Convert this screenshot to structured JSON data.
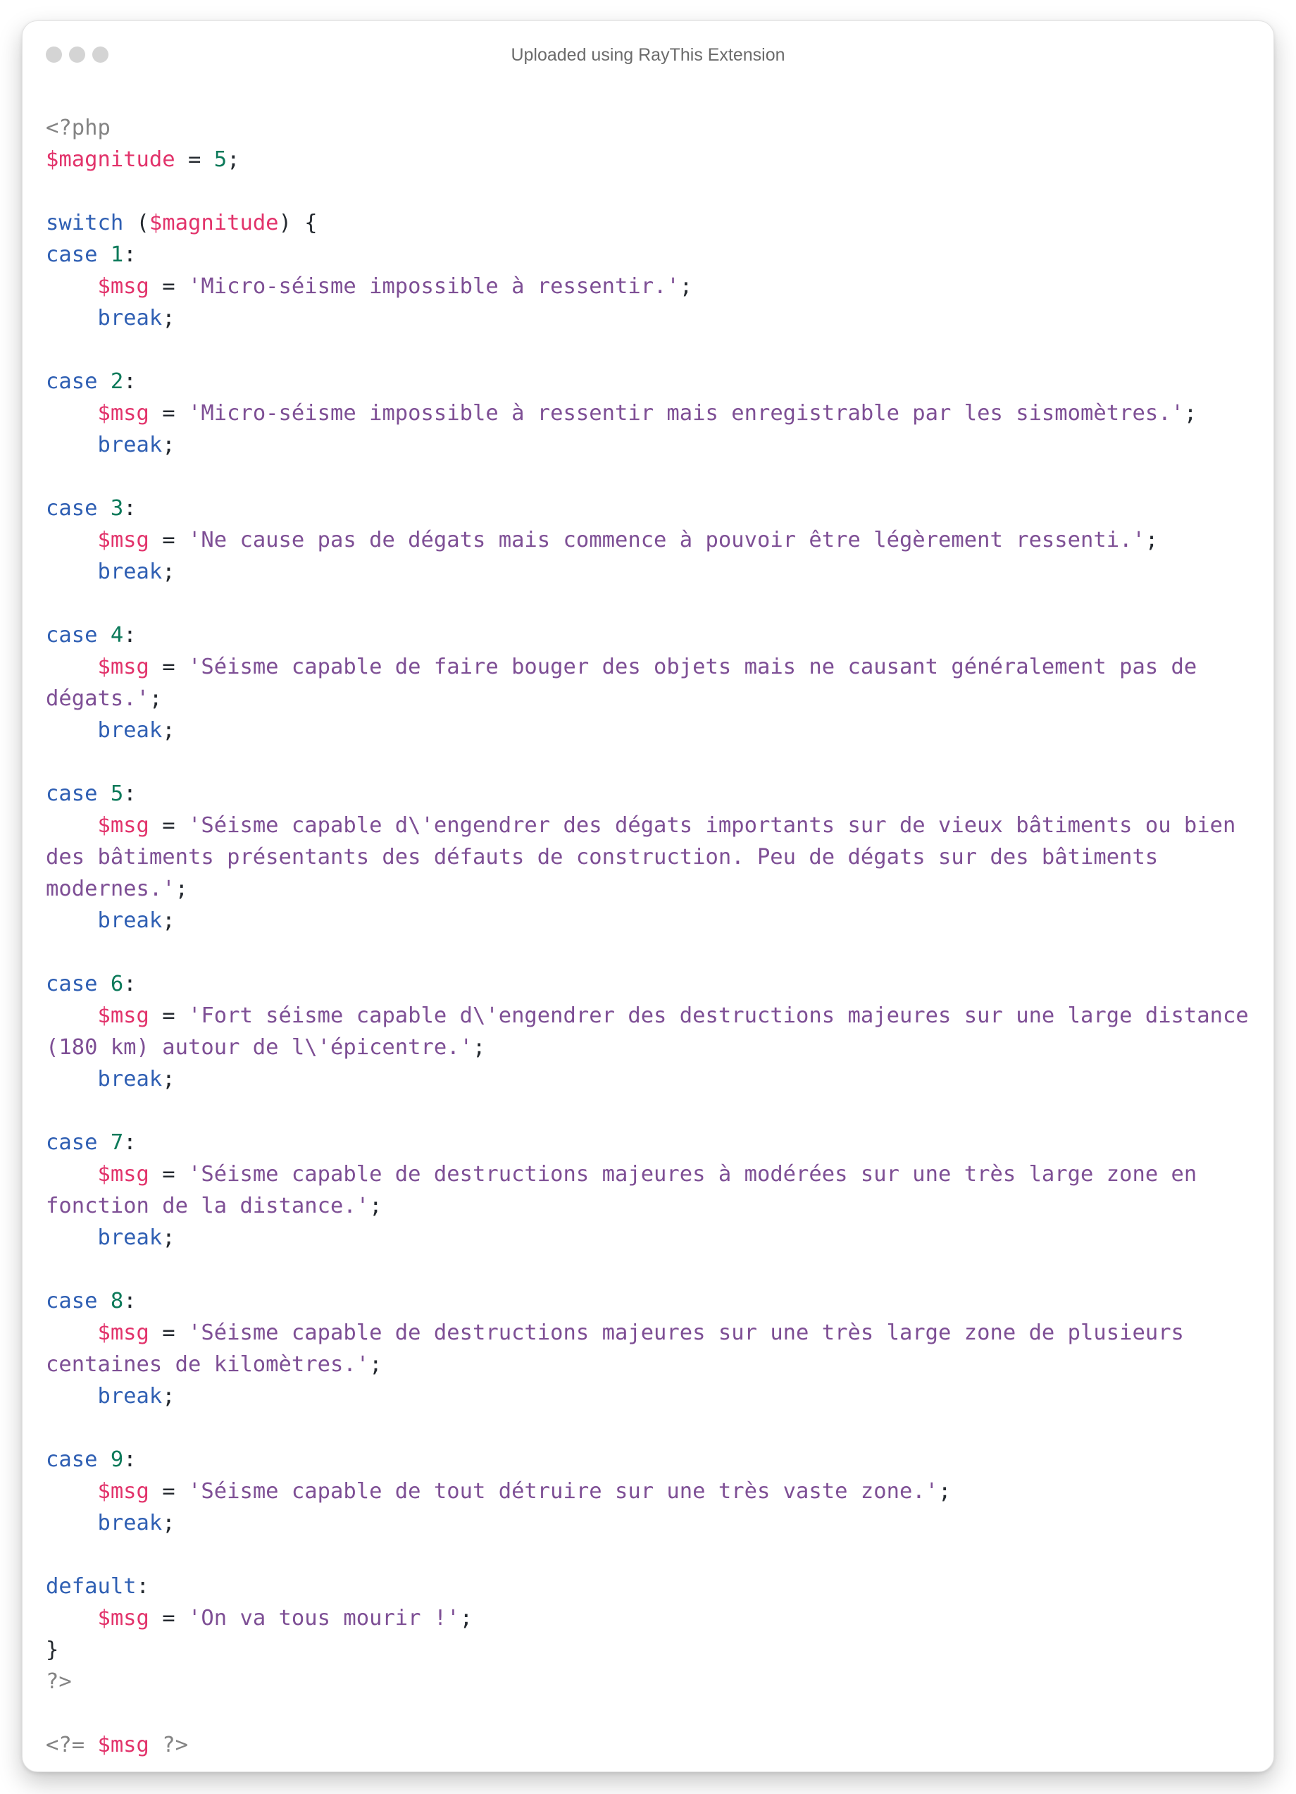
{
  "window": {
    "title": "Uploaded using RayThis Extension"
  },
  "colors": {
    "variable": "#e2336b",
    "keyword": "#2f5fb3",
    "number": "#0c7a5a",
    "string": "#7e4f95",
    "meta": "#848484",
    "plain": "#24292f"
  },
  "code": {
    "lines": [
      [
        {
          "t": "meta",
          "v": "<?php"
        }
      ],
      [
        {
          "t": "var",
          "v": "$magnitude"
        },
        {
          "t": "plain",
          "v": " = "
        },
        {
          "t": "num",
          "v": "5"
        },
        {
          "t": "plain",
          "v": ";"
        }
      ],
      [],
      [
        {
          "t": "kw",
          "v": "switch"
        },
        {
          "t": "plain",
          "v": " ("
        },
        {
          "t": "var",
          "v": "$magnitude"
        },
        {
          "t": "plain",
          "v": ") {"
        }
      ],
      [
        {
          "t": "kw",
          "v": "case"
        },
        {
          "t": "plain",
          "v": " "
        },
        {
          "t": "num",
          "v": "1"
        },
        {
          "t": "plain",
          "v": ":"
        }
      ],
      [
        {
          "t": "plain",
          "v": "    "
        },
        {
          "t": "var",
          "v": "$msg"
        },
        {
          "t": "plain",
          "v": " = "
        },
        {
          "t": "str",
          "v": "'Micro-séisme impossible à ressentir.'"
        },
        {
          "t": "plain",
          "v": ";"
        }
      ],
      [
        {
          "t": "plain",
          "v": "    "
        },
        {
          "t": "kw",
          "v": "break"
        },
        {
          "t": "plain",
          "v": ";"
        }
      ],
      [],
      [
        {
          "t": "kw",
          "v": "case"
        },
        {
          "t": "plain",
          "v": " "
        },
        {
          "t": "num",
          "v": "2"
        },
        {
          "t": "plain",
          "v": ":"
        }
      ],
      [
        {
          "t": "plain",
          "v": "    "
        },
        {
          "t": "var",
          "v": "$msg"
        },
        {
          "t": "plain",
          "v": " = "
        },
        {
          "t": "str",
          "v": "'Micro-séisme impossible à ressentir mais enregistrable par les sismomètres.'"
        },
        {
          "t": "plain",
          "v": ";"
        }
      ],
      [
        {
          "t": "plain",
          "v": "    "
        },
        {
          "t": "kw",
          "v": "break"
        },
        {
          "t": "plain",
          "v": ";"
        }
      ],
      [],
      [
        {
          "t": "kw",
          "v": "case"
        },
        {
          "t": "plain",
          "v": " "
        },
        {
          "t": "num",
          "v": "3"
        },
        {
          "t": "plain",
          "v": ":"
        }
      ],
      [
        {
          "t": "plain",
          "v": "    "
        },
        {
          "t": "var",
          "v": "$msg"
        },
        {
          "t": "plain",
          "v": " = "
        },
        {
          "t": "str",
          "v": "'Ne cause pas de dégats mais commence à pouvoir être légèrement ressenti.'"
        },
        {
          "t": "plain",
          "v": ";"
        }
      ],
      [
        {
          "t": "plain",
          "v": "    "
        },
        {
          "t": "kw",
          "v": "break"
        },
        {
          "t": "plain",
          "v": ";"
        }
      ],
      [],
      [
        {
          "t": "kw",
          "v": "case"
        },
        {
          "t": "plain",
          "v": " "
        },
        {
          "t": "num",
          "v": "4"
        },
        {
          "t": "plain",
          "v": ":"
        }
      ],
      [
        {
          "t": "plain",
          "v": "    "
        },
        {
          "t": "var",
          "v": "$msg"
        },
        {
          "t": "plain",
          "v": " = "
        },
        {
          "t": "str",
          "v": "'Séisme capable de faire bouger des objets mais ne causant généralement pas de"
        }
      ],
      [
        {
          "t": "str",
          "v": "dégats.'"
        },
        {
          "t": "plain",
          "v": ";"
        }
      ],
      [
        {
          "t": "plain",
          "v": "    "
        },
        {
          "t": "kw",
          "v": "break"
        },
        {
          "t": "plain",
          "v": ";"
        }
      ],
      [],
      [
        {
          "t": "kw",
          "v": "case"
        },
        {
          "t": "plain",
          "v": " "
        },
        {
          "t": "num",
          "v": "5"
        },
        {
          "t": "plain",
          "v": ":"
        }
      ],
      [
        {
          "t": "plain",
          "v": "    "
        },
        {
          "t": "var",
          "v": "$msg"
        },
        {
          "t": "plain",
          "v": " = "
        },
        {
          "t": "str",
          "v": "'Séisme capable d\\'engendrer des dégats importants sur de vieux bâtiments ou bien"
        }
      ],
      [
        {
          "t": "str",
          "v": "des bâtiments présentants des défauts de construction. Peu de dégats sur des bâtiments"
        }
      ],
      [
        {
          "t": "str",
          "v": "modernes.'"
        },
        {
          "t": "plain",
          "v": ";"
        }
      ],
      [
        {
          "t": "plain",
          "v": "    "
        },
        {
          "t": "kw",
          "v": "break"
        },
        {
          "t": "plain",
          "v": ";"
        }
      ],
      [],
      [
        {
          "t": "kw",
          "v": "case"
        },
        {
          "t": "plain",
          "v": " "
        },
        {
          "t": "num",
          "v": "6"
        },
        {
          "t": "plain",
          "v": ":"
        }
      ],
      [
        {
          "t": "plain",
          "v": "    "
        },
        {
          "t": "var",
          "v": "$msg"
        },
        {
          "t": "plain",
          "v": " = "
        },
        {
          "t": "str",
          "v": "'Fort séisme capable d\\'engendrer des destructions majeures sur une large distance"
        }
      ],
      [
        {
          "t": "str",
          "v": "(180 km) autour de l\\'épicentre.'"
        },
        {
          "t": "plain",
          "v": ";"
        }
      ],
      [
        {
          "t": "plain",
          "v": "    "
        },
        {
          "t": "kw",
          "v": "break"
        },
        {
          "t": "plain",
          "v": ";"
        }
      ],
      [],
      [
        {
          "t": "kw",
          "v": "case"
        },
        {
          "t": "plain",
          "v": " "
        },
        {
          "t": "num",
          "v": "7"
        },
        {
          "t": "plain",
          "v": ":"
        }
      ],
      [
        {
          "t": "plain",
          "v": "    "
        },
        {
          "t": "var",
          "v": "$msg"
        },
        {
          "t": "plain",
          "v": " = "
        },
        {
          "t": "str",
          "v": "'Séisme capable de destructions majeures à modérées sur une très large zone en"
        }
      ],
      [
        {
          "t": "str",
          "v": "fonction de la distance.'"
        },
        {
          "t": "plain",
          "v": ";"
        }
      ],
      [
        {
          "t": "plain",
          "v": "    "
        },
        {
          "t": "kw",
          "v": "break"
        },
        {
          "t": "plain",
          "v": ";"
        }
      ],
      [],
      [
        {
          "t": "kw",
          "v": "case"
        },
        {
          "t": "plain",
          "v": " "
        },
        {
          "t": "num",
          "v": "8"
        },
        {
          "t": "plain",
          "v": ":"
        }
      ],
      [
        {
          "t": "plain",
          "v": "    "
        },
        {
          "t": "var",
          "v": "$msg"
        },
        {
          "t": "plain",
          "v": " = "
        },
        {
          "t": "str",
          "v": "'Séisme capable de destructions majeures sur une très large zone de plusieurs"
        }
      ],
      [
        {
          "t": "str",
          "v": "centaines de kilomètres.'"
        },
        {
          "t": "plain",
          "v": ";"
        }
      ],
      [
        {
          "t": "plain",
          "v": "    "
        },
        {
          "t": "kw",
          "v": "break"
        },
        {
          "t": "plain",
          "v": ";"
        }
      ],
      [],
      [
        {
          "t": "kw",
          "v": "case"
        },
        {
          "t": "plain",
          "v": " "
        },
        {
          "t": "num",
          "v": "9"
        },
        {
          "t": "plain",
          "v": ":"
        }
      ],
      [
        {
          "t": "plain",
          "v": "    "
        },
        {
          "t": "var",
          "v": "$msg"
        },
        {
          "t": "plain",
          "v": " = "
        },
        {
          "t": "str",
          "v": "'Séisme capable de tout détruire sur une très vaste zone.'"
        },
        {
          "t": "plain",
          "v": ";"
        }
      ],
      [
        {
          "t": "plain",
          "v": "    "
        },
        {
          "t": "kw",
          "v": "break"
        },
        {
          "t": "plain",
          "v": ";"
        }
      ],
      [],
      [
        {
          "t": "kw",
          "v": "default"
        },
        {
          "t": "plain",
          "v": ":"
        }
      ],
      [
        {
          "t": "plain",
          "v": "    "
        },
        {
          "t": "var",
          "v": "$msg"
        },
        {
          "t": "plain",
          "v": " = "
        },
        {
          "t": "str",
          "v": "'On va tous mourir !'"
        },
        {
          "t": "plain",
          "v": ";"
        }
      ],
      [
        {
          "t": "plain",
          "v": "}"
        }
      ],
      [
        {
          "t": "meta",
          "v": "?>"
        }
      ],
      [],
      [
        {
          "t": "meta",
          "v": "<?= "
        },
        {
          "t": "var",
          "v": "$msg"
        },
        {
          "t": "meta",
          "v": " ?>"
        }
      ]
    ]
  }
}
